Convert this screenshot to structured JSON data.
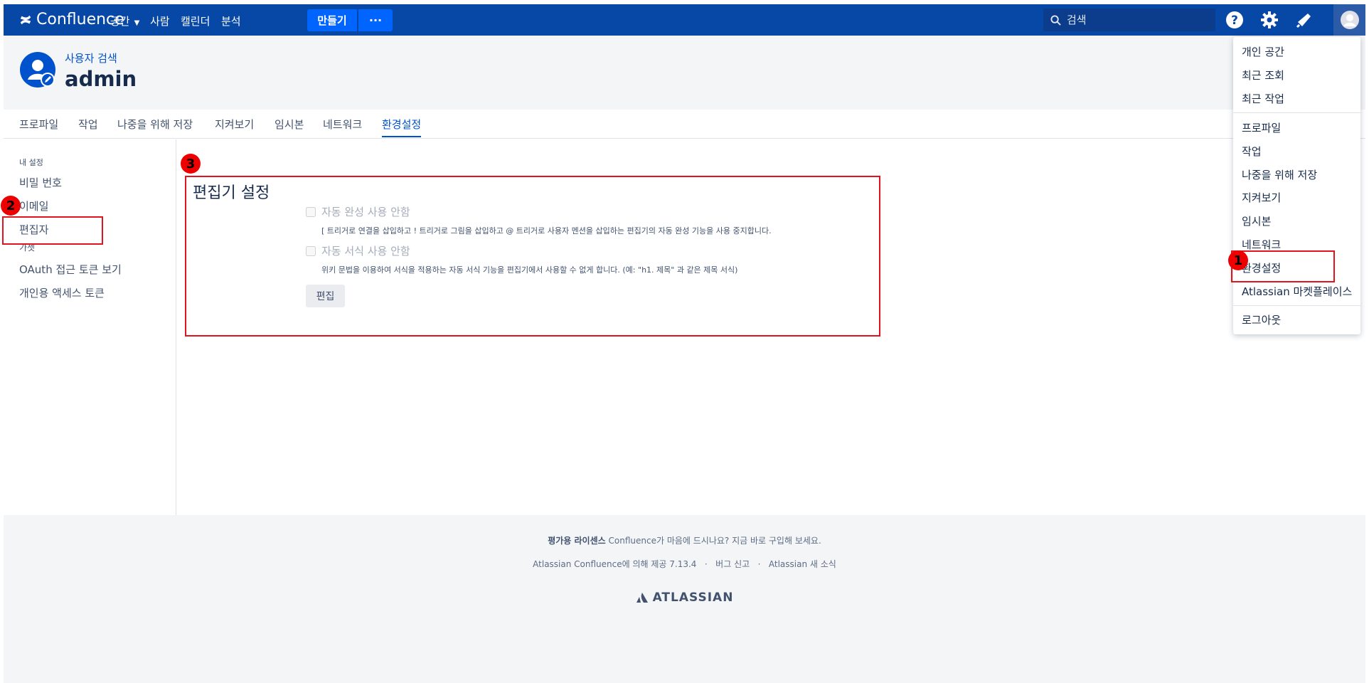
{
  "topnav": {
    "logo": "Confluence",
    "items": [
      "공간",
      "사람",
      "캘린더",
      "분석"
    ],
    "create": "만들기",
    "more": "···",
    "search_placeholder": "검색"
  },
  "header": {
    "breadcrumb": "사용자 검색",
    "title": "admin"
  },
  "tabs": [
    "프로파일",
    "작업",
    "나중을 위해 저장",
    "지켜보기",
    "임시본",
    "네트워크",
    "환경설정"
  ],
  "sidebar": {
    "heading": "내 설정",
    "items": [
      "비밀 번호",
      "이메일",
      "편집자",
      "가젯",
      "OAuth 접근 토큰 보기",
      "개인용 액세스 토큰"
    ]
  },
  "main": {
    "title": "편집기 설정",
    "option1": {
      "label": "자동 완성 사용 안함",
      "help": "[ 트리거로 연결을 삽입하고 ! 트리거로 그림을 삽입하고 @ 트리거로 사용자 멘션을 삽입하는 편집기의 자동 완성 기능을 사용 중지합니다."
    },
    "option2": {
      "label": "자동 서식 사용 안함",
      "help": "위키 문법을 이용하여 서식을 적용하는 자동 서식 기능을 편집기에서 사용할 수 없게 합니다. (예: \"h1. 제목\" 과 같은 제목 서식)"
    },
    "edit_button": "편집"
  },
  "footer": {
    "license_bold": "평가용 라이센스",
    "license_text": " Confluence가 마음에 드시나요? 지금 바로 구입해 보세요.",
    "powered": "Atlassian Confluence에 의해 제공 7.13.4",
    "sep": "·",
    "bug": "버그 신고",
    "news": "Atlassian 새 소식",
    "logo": "ATLASSIAN"
  },
  "dropdown": {
    "group1": [
      "개인 공간",
      "최근 조회",
      "최근 작업"
    ],
    "group2": [
      "프로파일",
      "작업",
      "나중을 위해 저장",
      "지켜보기",
      "임시본",
      "네트워크",
      "환경설정",
      "Atlassian 마켓플레이스"
    ],
    "group3": [
      "로그아웃"
    ]
  },
  "annotations": [
    "1",
    "2",
    "3"
  ],
  "colors": {
    "nav_bg": "#0747a6",
    "create_btn": "#0065ff",
    "link": "#0052cc",
    "annotation_red": "#e0141e"
  }
}
